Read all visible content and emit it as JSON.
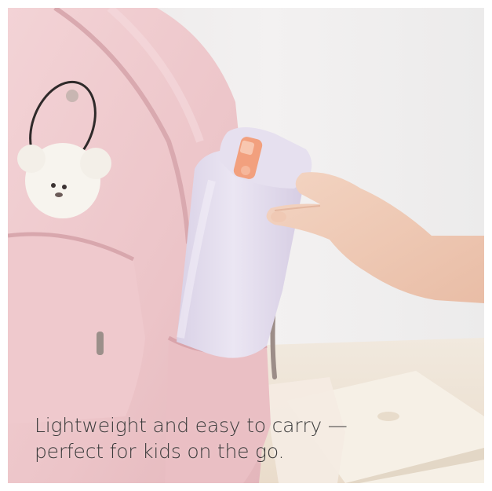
{
  "image": {
    "description_icons": [
      "backpack-icon",
      "bottle-icon",
      "hand-icon",
      "plush-keychain-icon",
      "notebook-icon"
    ],
    "colors": {
      "background": "#efeded",
      "backpack": "#eec9cc",
      "bottle": "#e5dff0",
      "lid_accent": "#f2a07e",
      "skin": "#f1cdb8",
      "table": "#efe5d8"
    }
  },
  "caption": {
    "line1": "Lightweight and easy to carry —",
    "line2": "perfect for kids on the go."
  }
}
